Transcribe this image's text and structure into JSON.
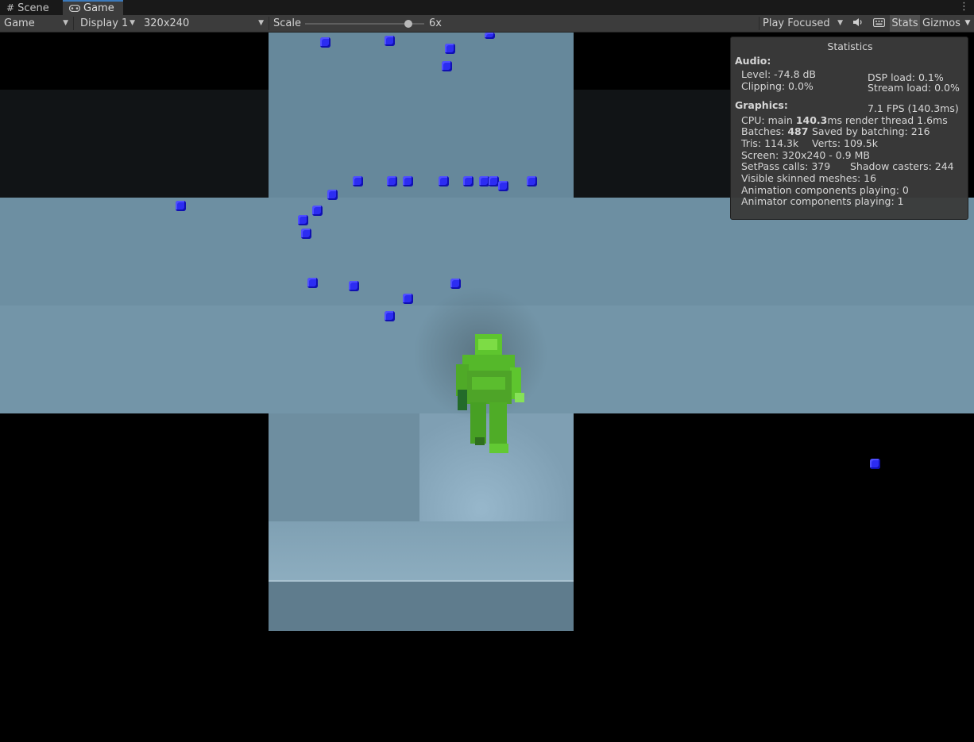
{
  "tabs": [
    {
      "label": "Scene",
      "icon": "grid-icon"
    },
    {
      "label": "Game",
      "icon": "gamepad-icon"
    }
  ],
  "toolbar": {
    "view_mode": "Game",
    "display": "Display 1",
    "resolution": "320x240",
    "scale_label": "Scale",
    "scale_value": "6x",
    "play_mode": "Play Focused",
    "stats_label": "Stats",
    "gizmos_label": "Gizmos"
  },
  "stats": {
    "title": "Statistics",
    "audio_header": "Audio:",
    "audio_level": "Level: -74.8 dB",
    "audio_clipping": "Clipping: 0.0%",
    "dsp_load": "DSP load: 0.1%",
    "stream_load": "Stream load: 0.0%",
    "graphics_header": "Graphics:",
    "fps": "7.1 FPS (140.3ms)",
    "cpu_prefix": "CPU: main ",
    "cpu_main": "140.3",
    "cpu_suffix": "ms  render thread 1.6ms",
    "batches_prefix": "Batches: ",
    "batches": "487",
    "saved_by_batching": "Saved by batching: 216",
    "tris": "Tris: 114.3k",
    "verts": "Verts: 109.5k",
    "screen": "Screen: 320x240 - 0.9 MB",
    "setpass": "SetPass calls: 379",
    "shadow_casters": "Shadow casters: 244",
    "skinned_meshes": "Visible skinned meshes: 16",
    "animation_components": "Animation components playing: 0",
    "animator_components": "Animator components playing: 1"
  },
  "colors": {
    "editor_bg": "#3c3c3c",
    "tab_accent": "#3a79bb",
    "floor": "#7f9fb1",
    "gem_blue": "#2c2cf2",
    "player_green": "#55c62a"
  }
}
